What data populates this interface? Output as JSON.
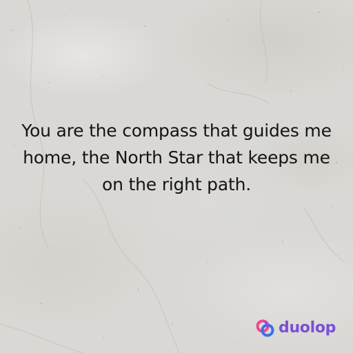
{
  "quote": {
    "text": "You are the compass that guides me home, the North Star that keeps me on the right path."
  },
  "brand": {
    "name": "duolop",
    "icon": "duolop-rings-icon",
    "name_color": "#7b4fd6",
    "icon_colors": [
      "#f0468c",
      "#3c6ee8",
      "#8f4fe0"
    ]
  },
  "colors": {
    "background": "#d9d8d4",
    "text": "#141414"
  }
}
